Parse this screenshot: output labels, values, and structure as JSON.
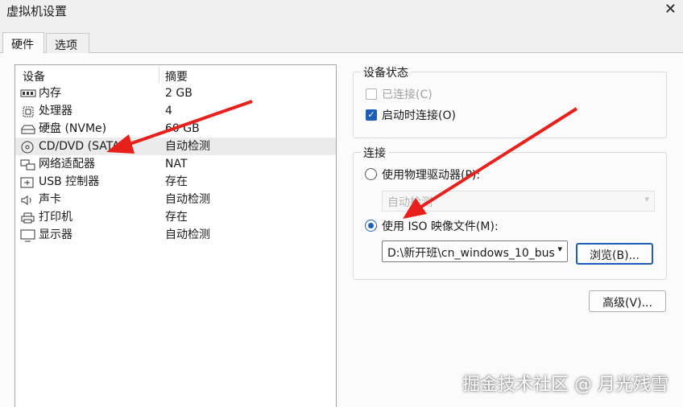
{
  "window": {
    "title": "虚拟机设置",
    "close_symbol": "✕"
  },
  "tabs": [
    {
      "label": "硬件",
      "active": true
    },
    {
      "label": "选项",
      "active": false
    }
  ],
  "device_list": {
    "headers": {
      "device": "设备",
      "summary": "摘要"
    },
    "rows": [
      {
        "icon": "memory-icon",
        "name": "内存",
        "summary": "2 GB"
      },
      {
        "icon": "processor-icon",
        "name": "处理器",
        "summary": "4"
      },
      {
        "icon": "hard-disk-icon",
        "name": "硬盘 (NVMe)",
        "summary": "60 GB"
      },
      {
        "icon": "cd-dvd-icon",
        "name": "CD/DVD (SATA)",
        "summary": "自动检测",
        "selected": true
      },
      {
        "icon": "network-adapter-icon",
        "name": "网络适配器",
        "summary": "NAT"
      },
      {
        "icon": "usb-icon",
        "name": "USB 控制器",
        "summary": "存在"
      },
      {
        "icon": "sound-card-icon",
        "name": "声卡",
        "summary": "自动检测"
      },
      {
        "icon": "printer-icon",
        "name": "打印机",
        "summary": "存在"
      },
      {
        "icon": "display-icon",
        "name": "显示器",
        "summary": "自动检测"
      }
    ]
  },
  "device_status": {
    "label": "设备状态",
    "connected": {
      "label": "已连接(C)",
      "checked": false,
      "enabled": false
    },
    "connect_at_power_on": {
      "label": "启动时连接(O)",
      "checked": true,
      "enabled": true
    }
  },
  "connection": {
    "label": "连接",
    "physical_drive": {
      "label": "使用物理驱动器(P):",
      "selected": false,
      "value": "自动检测"
    },
    "iso_image": {
      "label": "使用 ISO 映像文件(M):",
      "selected": true,
      "path": "D:\\新开班\\cn_windows_10_bus"
    },
    "browse_label": "浏览(B)..."
  },
  "advanced_label": "高级(V)...",
  "watermark": "掘金技术社区 @ 月光残雪",
  "colors": {
    "accent": "#1e5fb5",
    "annotation_arrow": "#e8201c"
  }
}
